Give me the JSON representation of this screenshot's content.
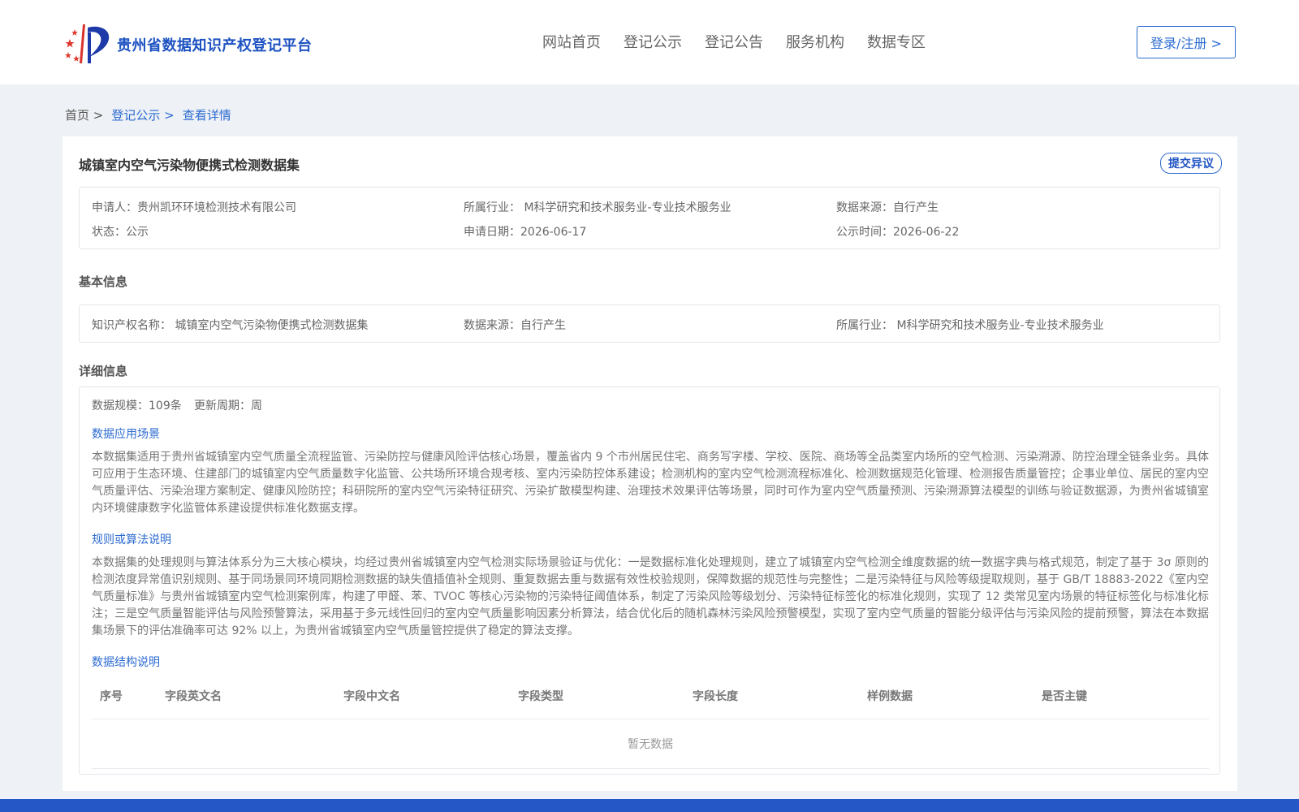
{
  "header": {
    "site_title": "贵州省数据知识产权登记平台",
    "nav": [
      "网站首页",
      "登记公示",
      "登记公告",
      "服务机构",
      "数据专区"
    ],
    "login_label": "登录/注册 >"
  },
  "breadcrumb": {
    "home": "首页 >",
    "level2": "登记公示 >",
    "current": "查看详情"
  },
  "detail": {
    "title": "城镇室内空气污染物便携式检测数据集",
    "objection_label": "提交异议",
    "summary": {
      "applicant": "申请人：贵州凯环环境检测技术有限公司",
      "industry": "所属行业： M科学研究和技术服务业-专业技术服务业",
      "source": "数据来源：自行产生",
      "status": "状态：公示",
      "apply_date": "申请日期：2026-06-17",
      "publish_date": "公示时间：2026-06-22"
    },
    "basic": {
      "section_title": "基本信息",
      "ip_name": "知识产权名称： 城镇室内空气污染物便携式检测数据集",
      "source": "数据来源：自行产生",
      "industry": "所属行业： M科学研究和技术服务业-专业技术服务业"
    },
    "info": {
      "section_title": "详细信息",
      "scale": "数据规模：109条",
      "cycle": "更新周期：周",
      "scenario_title": "数据应用场景",
      "scenario_text": "本数据集适用于贵州省城镇室内空气质量全流程监管、污染防控与健康风险评估核心场景，覆盖省内 9 个市州居民住宅、商务写字楼、学校、医院、商场等全品类室内场所的空气检测、污染溯源、防控治理全链条业务。具体可应用于生态环境、住建部门的城镇室内空气质量数字化监管、公共场所环境合规考核、室内污染防控体系建设；检测机构的室内空气检测流程标准化、检测数据规范化管理、检测报告质量管控；企事业单位、居民的室内空气质量评估、污染治理方案制定、健康风险防控；科研院所的室内空气污染特征研究、污染扩散模型构建、治理技术效果评估等场景，同时可作为室内空气质量预测、污染溯源算法模型的训练与验证数据源，为贵州省城镇室内环境健康数字化监管体系建设提供标准化数据支撑。",
      "rules_title": "规则或算法说明",
      "rules_text": "本数据集的处理规则与算法体系分为三大核心模块，均经过贵州省城镇室内空气检测实际场景验证与优化：一是数据标准化处理规则，建立了城镇室内空气检测全维度数据的统一数据字典与格式规范，制定了基于 3σ 原则的检测浓度异常值识别规则、基于同场景同环境同期检测数据的缺失值插值补全规则、重复数据去重与数据有效性校验规则，保障数据的规范性与完整性；二是污染特征与风险等级提取规则，基于 GB/T 18883-2022《室内空气质量标准》与贵州省城镇室内空气检测案例库，构建了甲醛、苯、TVOC 等核心污染物的污染特征阈值体系，制定了污染风险等级划分、污染特征标签化的标准化规则，实现了 12 类常见室内场景的特征标签化与标准化标注；三是空气质量智能评估与风险预警算法，采用基于多元线性回归的室内空气质量影响因素分析算法，结合优化后的随机森林污染风险预警模型，实现了室内空气质量的智能分级评估与污染风险的提前预警，算法在本数据集场景下的评估准确率可达 92% 以上，为贵州省城镇室内空气质量管控提供了稳定的算法支撑。",
      "structure_title": "数据结构说明",
      "table_headers": [
        "序号",
        "字段英文名",
        "字段中文名",
        "字段类型",
        "字段长度",
        "样例数据",
        "是否主键"
      ],
      "empty_text": "暂无数据"
    }
  },
  "colors": {
    "brand": "#1d52c2",
    "link": "#2c6bd1",
    "footer": "#2558c6",
    "background": "#eef1f5"
  },
  "icons": {
    "logo": "stars-flag-logo-icon"
  }
}
